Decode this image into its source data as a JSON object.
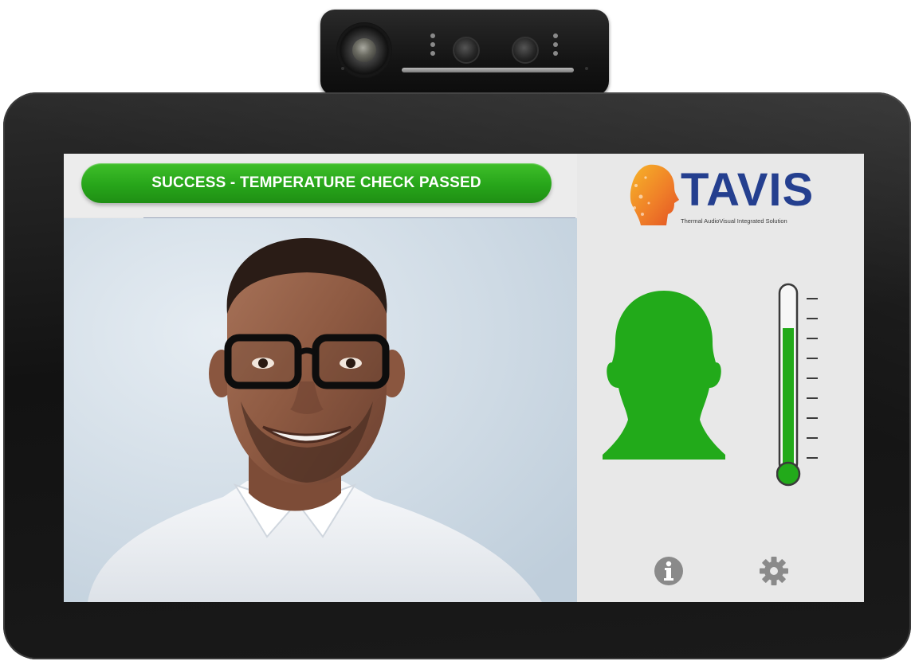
{
  "status": {
    "message": "SUCCESS - TEMPERATURE CHECK PASSED",
    "state": "passed",
    "color": "#27a51a"
  },
  "brand": {
    "name": "TAVIS",
    "tagline": "Thermal AudioVisual Integrated Solution",
    "name_color": "#243f8f"
  },
  "indicators": {
    "head_icon": "head-silhouette-icon",
    "head_color": "#22aa1a",
    "thermometer_icon": "thermometer-icon",
    "thermometer_level": 0.78,
    "thermometer_color": "#22aa1a"
  },
  "controls": {
    "info_icon": "info-icon",
    "settings_icon": "gear-icon"
  }
}
